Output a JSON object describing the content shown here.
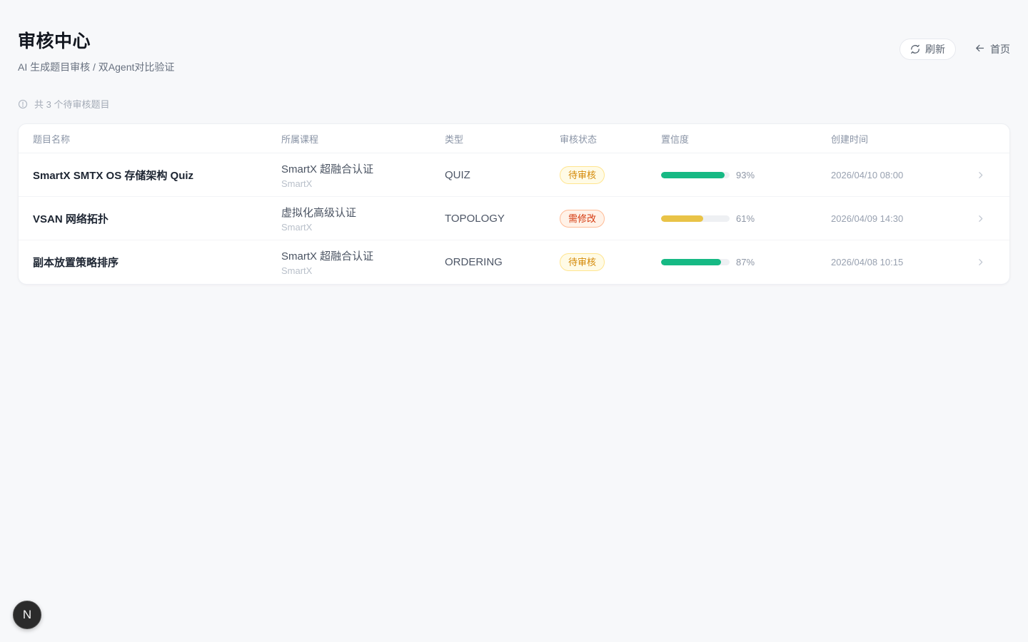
{
  "page": {
    "title": "审核中心",
    "subtitle": "AI 生成题目审核 / 双Agent对比验证",
    "summary": "共 3 个待审核题目"
  },
  "actions": {
    "refresh_label": "刷新",
    "home_label": "首页",
    "back_arrow": "←"
  },
  "icons": {
    "info": "info-circle-icon",
    "refresh": "refresh-icon",
    "back": "arrow-left-icon",
    "row_chevron": "chevron-right-icon"
  },
  "table": {
    "columns": {
      "title": "题目名称",
      "course": "所属课程",
      "type": "类型",
      "status": "审核状态",
      "confidence": "置信度",
      "created": "创建时间"
    },
    "rows": [
      {
        "title": "SmartX SMTX OS 存储架构 Quiz",
        "course": "SmartX 超融合认证",
        "course_sub": "SmartX",
        "type": "QUIZ",
        "status": "待审核",
        "status_kind": "pending",
        "confidence": 93,
        "confidence_label": "93%",
        "confidence_level": "high",
        "created": "2026/04/10 08:00"
      },
      {
        "title": "VSAN 网络拓扑",
        "course": "虚拟化高级认证",
        "course_sub": "SmartX",
        "type": "TOPOLOGY",
        "status": "需修改",
        "status_kind": "revise",
        "confidence": 61,
        "confidence_label": "61%",
        "confidence_level": "mid",
        "created": "2026/04/09 14:30"
      },
      {
        "title": "副本放置策略排序",
        "course": "SmartX 超融合认证",
        "course_sub": "SmartX",
        "type": "ORDERING",
        "status": "待审核",
        "status_kind": "pending",
        "confidence": 87,
        "confidence_label": "87%",
        "confidence_level": "high",
        "created": "2026/04/08 10:15"
      }
    ]
  },
  "colors": {
    "page_bg": "#f7f8fa",
    "confidence_high": "#16b984",
    "confidence_mid": "#e9c347",
    "badge_pending_text": "#d48806",
    "badge_pending_bg": "#fffbe6",
    "badge_pending_border": "#ffe58f",
    "badge_revise_text": "#d4380d",
    "badge_revise_bg": "#fff2e8",
    "badge_revise_border": "#ffbb96"
  },
  "floating_badge": {
    "label": "N"
  }
}
